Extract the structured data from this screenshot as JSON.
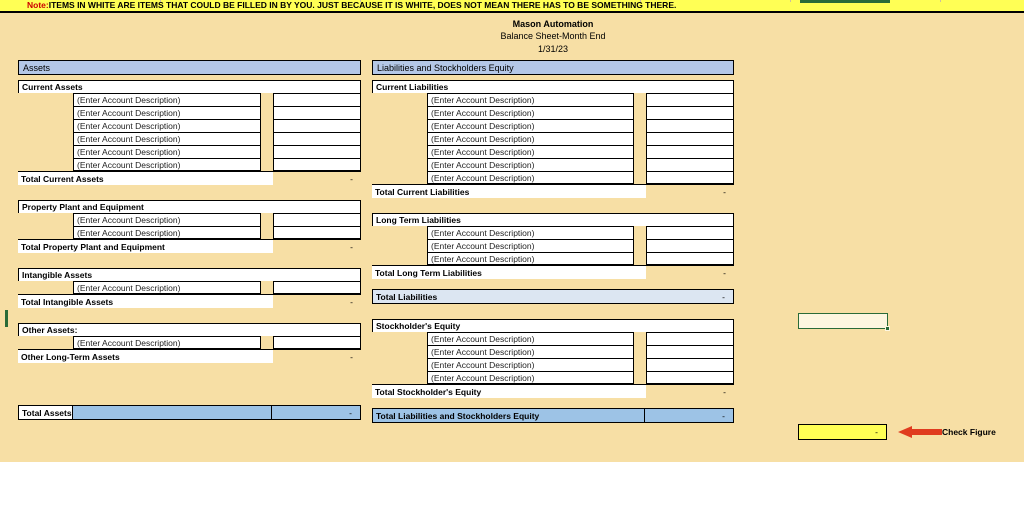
{
  "note": {
    "label": "Note:",
    "text": "ITEMS IN WHITE ARE ITEMS THAT COULD BE FILLED IN BY YOU.  JUST BECAUSE IT IS WHITE, DOES NOT MEAN THERE HAS TO BE SOMETHING THERE."
  },
  "title": {
    "company": "Mason Automation",
    "statement": "Balance Sheet-Month End",
    "date": "1/31/23"
  },
  "placeholders": {
    "account": "(Enter Account Description)"
  },
  "values": {
    "dash": "-",
    "blank": ""
  },
  "colors": {
    "sheet_background": "#f7dfa5",
    "note_background": "#ffff55",
    "note_label": "#cc0000",
    "header_blue": "#b4c7e7",
    "total_blue": "#9dc3e6",
    "light_blue": "#dce6f2",
    "selection_green": "#2a6b38",
    "arrow_red": "#e03c1f",
    "check_yellow": "#ffff55"
  },
  "assets": {
    "header": "Assets",
    "groups": [
      {
        "heading": "Current Assets",
        "rows": [
          "(Enter Account Description)",
          "(Enter Account Description)",
          "(Enter Account Description)",
          "(Enter Account Description)",
          "(Enter Account Description)",
          "(Enter Account Description)"
        ],
        "total_label": "Total Current Assets",
        "total_value": "-"
      },
      {
        "heading": "Property Plant and Equipment",
        "rows": [
          "(Enter Account Description)",
          "(Enter Account Description)"
        ],
        "total_label": "Total Property Plant and Equipment",
        "total_value": "-"
      },
      {
        "heading": "Intangible Assets",
        "rows": [
          "(Enter Account Description)"
        ],
        "total_label": "Total Intangible Assets",
        "total_value": "-"
      },
      {
        "heading": "Other Assets:",
        "rows": [
          "(Enter Account Description)"
        ],
        "total_label": "Other Long-Term Assets",
        "total_value": "-"
      }
    ],
    "grand_total_label": "Total Assets",
    "grand_total_value": "-"
  },
  "liabilities": {
    "header": "Liabilities and Stockholders Equity",
    "groups": [
      {
        "heading": "Current Liabilities",
        "rows": [
          "(Enter Account Description)",
          "(Enter Account Description)",
          "(Enter Account Description)",
          "(Enter Account Description)",
          "(Enter Account Description)",
          "(Enter Account Description)",
          "(Enter Account Description)"
        ],
        "total_label": "Total Current Liabilities",
        "total_value": "-"
      },
      {
        "heading": "Long Term Liabilities",
        "rows": [
          "(Enter Account Description)",
          "(Enter Account Description)",
          "(Enter Account Description)"
        ],
        "total_label": "Total Long Term Liabilities",
        "total_value": "-"
      }
    ],
    "total_liabilities_label": "Total Liabilities",
    "total_liabilities_value": "-",
    "equity": {
      "heading": "Stockholder's Equity",
      "rows": [
        "(Enter Account Description)",
        "(Enter Account Description)",
        "(Enter Account Description)",
        "(Enter Account Description)"
      ],
      "total_label": "Total Stockholder's Equity",
      "total_value": "-"
    },
    "grand_total_label": "Total Liabilities and Stockholders Equity",
    "grand_total_value": "-"
  },
  "check_figure": {
    "value": "-",
    "label": "Check Figure"
  }
}
